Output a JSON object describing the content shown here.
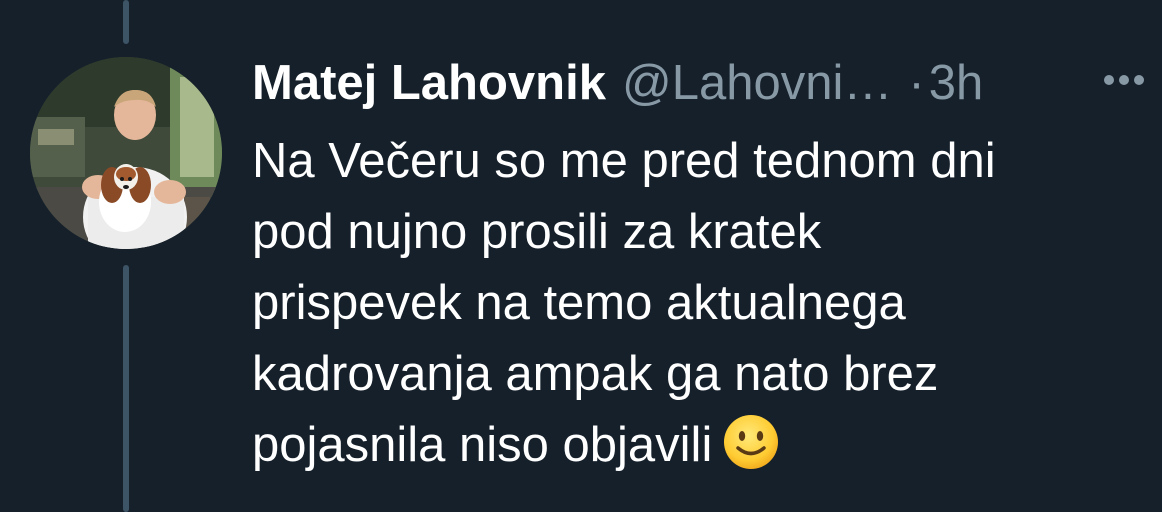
{
  "tweet": {
    "author": {
      "display_name": "Matej Lahovnik",
      "handle": "@Lahovni…",
      "avatar_icon": "profile-photo-man-with-dog"
    },
    "separator": "·",
    "time": "3h",
    "more_icon": "more-horizontal-icon",
    "text_lines": [
      "Na Večeru so me pred tednom dni",
      "pod nujno prosili za kratek",
      "prispevek na temo aktualnega",
      "kadrovanja ampak ga nato brez",
      "pojasnila niso objavili"
    ],
    "emoji_icon": "slightly-smiling-face-icon"
  },
  "colors": {
    "background": "#15202b",
    "primary_text": "#ffffff",
    "secondary_text": "#8899a6",
    "thread_line": "#3d5466"
  }
}
